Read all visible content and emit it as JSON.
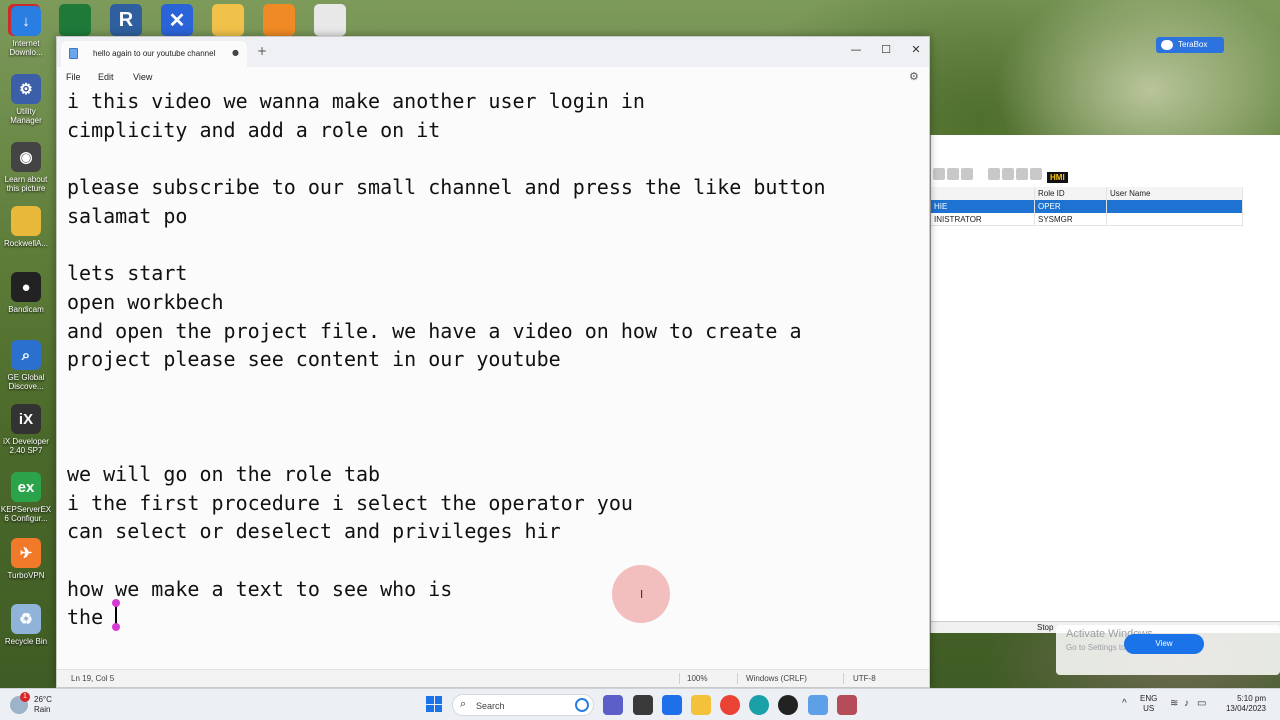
{
  "desktop": {
    "top_icons": [
      {
        "name": "adobe-icon",
        "color": "#cc2b2b",
        "glyph": ""
      },
      {
        "name": "kepware-icon",
        "color": "#1f7a3a",
        "glyph": ""
      },
      {
        "name": "r-icon",
        "color": "#2f5f9e",
        "glyph": "R"
      },
      {
        "name": "xmind-icon",
        "color": "#2b63d8",
        "glyph": "✕"
      },
      {
        "name": "folder-icon",
        "color": "#f0c24a",
        "glyph": ""
      },
      {
        "name": "key-icon",
        "color": "#f08a24",
        "glyph": ""
      },
      {
        "name": "document-icon",
        "color": "#e8e8e8",
        "glyph": ""
      }
    ],
    "left_icons": [
      {
        "label": "Internet Downlo...",
        "color": "#2a7de1",
        "glyph": "↓"
      },
      {
        "label": "Utility Manager",
        "color": "#3b5fa8",
        "glyph": "⚙"
      },
      {
        "label": "Learn about this picture",
        "color": "#444444",
        "glyph": "◉"
      },
      {
        "label": "RockwellA...",
        "color": "#e8b83a",
        "glyph": ""
      },
      {
        "label": "Bandicam",
        "color": "#222222",
        "glyph": "●"
      },
      {
        "label": "GE Global Discove...",
        "color": "#2b6fcf",
        "glyph": "⌕"
      },
      {
        "label": "iX Developer 2.40 SP7",
        "color": "#333333",
        "glyph": "iX"
      },
      {
        "label": "KEPServerEX 6 Configur...",
        "color": "#2aa34a",
        "glyph": "ex"
      },
      {
        "label": "TurboVPN",
        "color": "#f07a2a",
        "glyph": "✈"
      },
      {
        "label": "Recycle Bin",
        "color": "#8fb3d9",
        "glyph": "♻"
      }
    ]
  },
  "terabox": {
    "label": "TeraBox"
  },
  "background_window": {
    "hmi_label": "HMI",
    "columns": [
      "",
      "Role ID",
      "User Name"
    ],
    "rows": [
      {
        "c1": "HIE",
        "c2": "OPER",
        "c3": "",
        "selected": true
      },
      {
        "c1": "INISTRATOR",
        "c2": "SYSMGR",
        "c3": "",
        "selected": false
      }
    ],
    "status_text": "Stop"
  },
  "activate_windows": {
    "title": "Activate Windows",
    "subtitle": "Go to Settings to activate Windows.",
    "view_button": "View"
  },
  "notepad": {
    "tab_title": "hello again to our youtube channel",
    "tab_dot": "●",
    "new_tab": "+",
    "window_controls": {
      "minimize": "—",
      "maximize": "☐",
      "close": "✕"
    },
    "menu": {
      "file": "File",
      "edit": "Edit",
      "view": "View"
    },
    "lines": [
      "i this video we wanna make another user login in",
      "cimplicity and add a role on it",
      "",
      "please subscribe to our small channel and press the like button",
      "salamat po",
      "",
      "lets start",
      "open workbech",
      "and open the project file. we have a video on how to create a",
      "project please see content in our youtube",
      "",
      "",
      "",
      "we will go on the role tab",
      "i the first procedure i select the operator you",
      "can select or deselect and privileges hir",
      "",
      "how we make a text to see who is"
    ],
    "last_line": "the ",
    "status": {
      "position": "Ln 19, Col 5",
      "zoom": "100%",
      "line_ending": "Windows (CRLF)",
      "encoding": "UTF-8"
    }
  },
  "taskbar": {
    "weather_temp": "26°C",
    "weather_condition": "Rain",
    "weather_badge": "1",
    "search_placeholder": "Search",
    "lang_line1": "ENG",
    "lang_line2": "US",
    "time": "5:10 pm",
    "date": "13/04/2023",
    "caret_up": "^"
  }
}
